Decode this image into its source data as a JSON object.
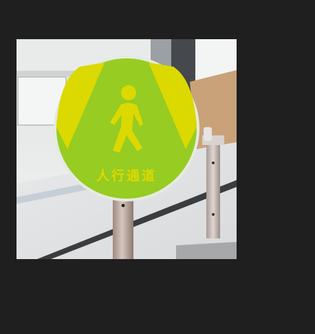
{
  "viewer": {
    "background_color": "#1f1f1f"
  },
  "photo": {
    "subject": "pedestrian-walkway-sign",
    "sign": {
      "text": "人行通道",
      "disc_color": "#97cc22",
      "beam_color": "#dcd900",
      "figure_color": "#dcd900",
      "icon": "walking-person-icon"
    }
  }
}
